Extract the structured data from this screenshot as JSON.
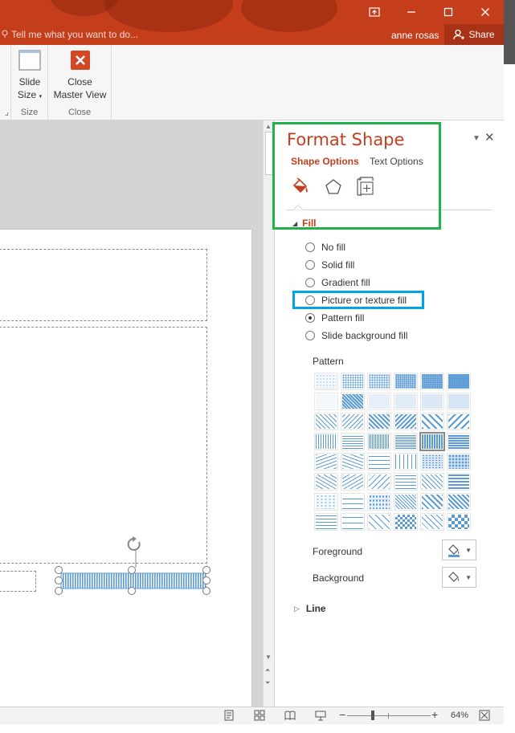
{
  "titlebar": {
    "tell_me": "Tell me what you want to do...",
    "user": "anne rosas",
    "share": "Share",
    "colors": {
      "bar": "#c43e1c",
      "share_bg": "#a83216"
    }
  },
  "ribbon": {
    "slide_size": {
      "line1": "Slide",
      "line2": "Size",
      "group": "Size"
    },
    "close_master": {
      "line1": "Close",
      "line2": "Master View",
      "group": "Close"
    }
  },
  "pane": {
    "title": "Format Shape",
    "tabs": {
      "shape_options": "Shape Options",
      "text_options": "Text Options"
    },
    "icons": [
      "fill-line-icon",
      "effects-pentagon-icon",
      "size-properties-icon"
    ],
    "fill_header": "Fill",
    "fill_options": [
      {
        "label": "No fill",
        "selected": false
      },
      {
        "label": "Solid fill",
        "selected": false
      },
      {
        "label": "Gradient fill",
        "selected": false
      },
      {
        "label": "Picture or texture fill",
        "selected": false
      },
      {
        "label": "Pattern fill",
        "selected": true
      },
      {
        "label": "Slide background fill",
        "selected": false
      }
    ],
    "pattern_label": "Pattern",
    "pattern_count": 48,
    "selected_pattern_index": 22,
    "foreground_label": "Foreground",
    "background_label": "Background",
    "line_header": "Line",
    "accent_color": "#c43e1c",
    "pattern_color": "#5b9bd5"
  },
  "statusbar": {
    "zoom": "64%"
  }
}
